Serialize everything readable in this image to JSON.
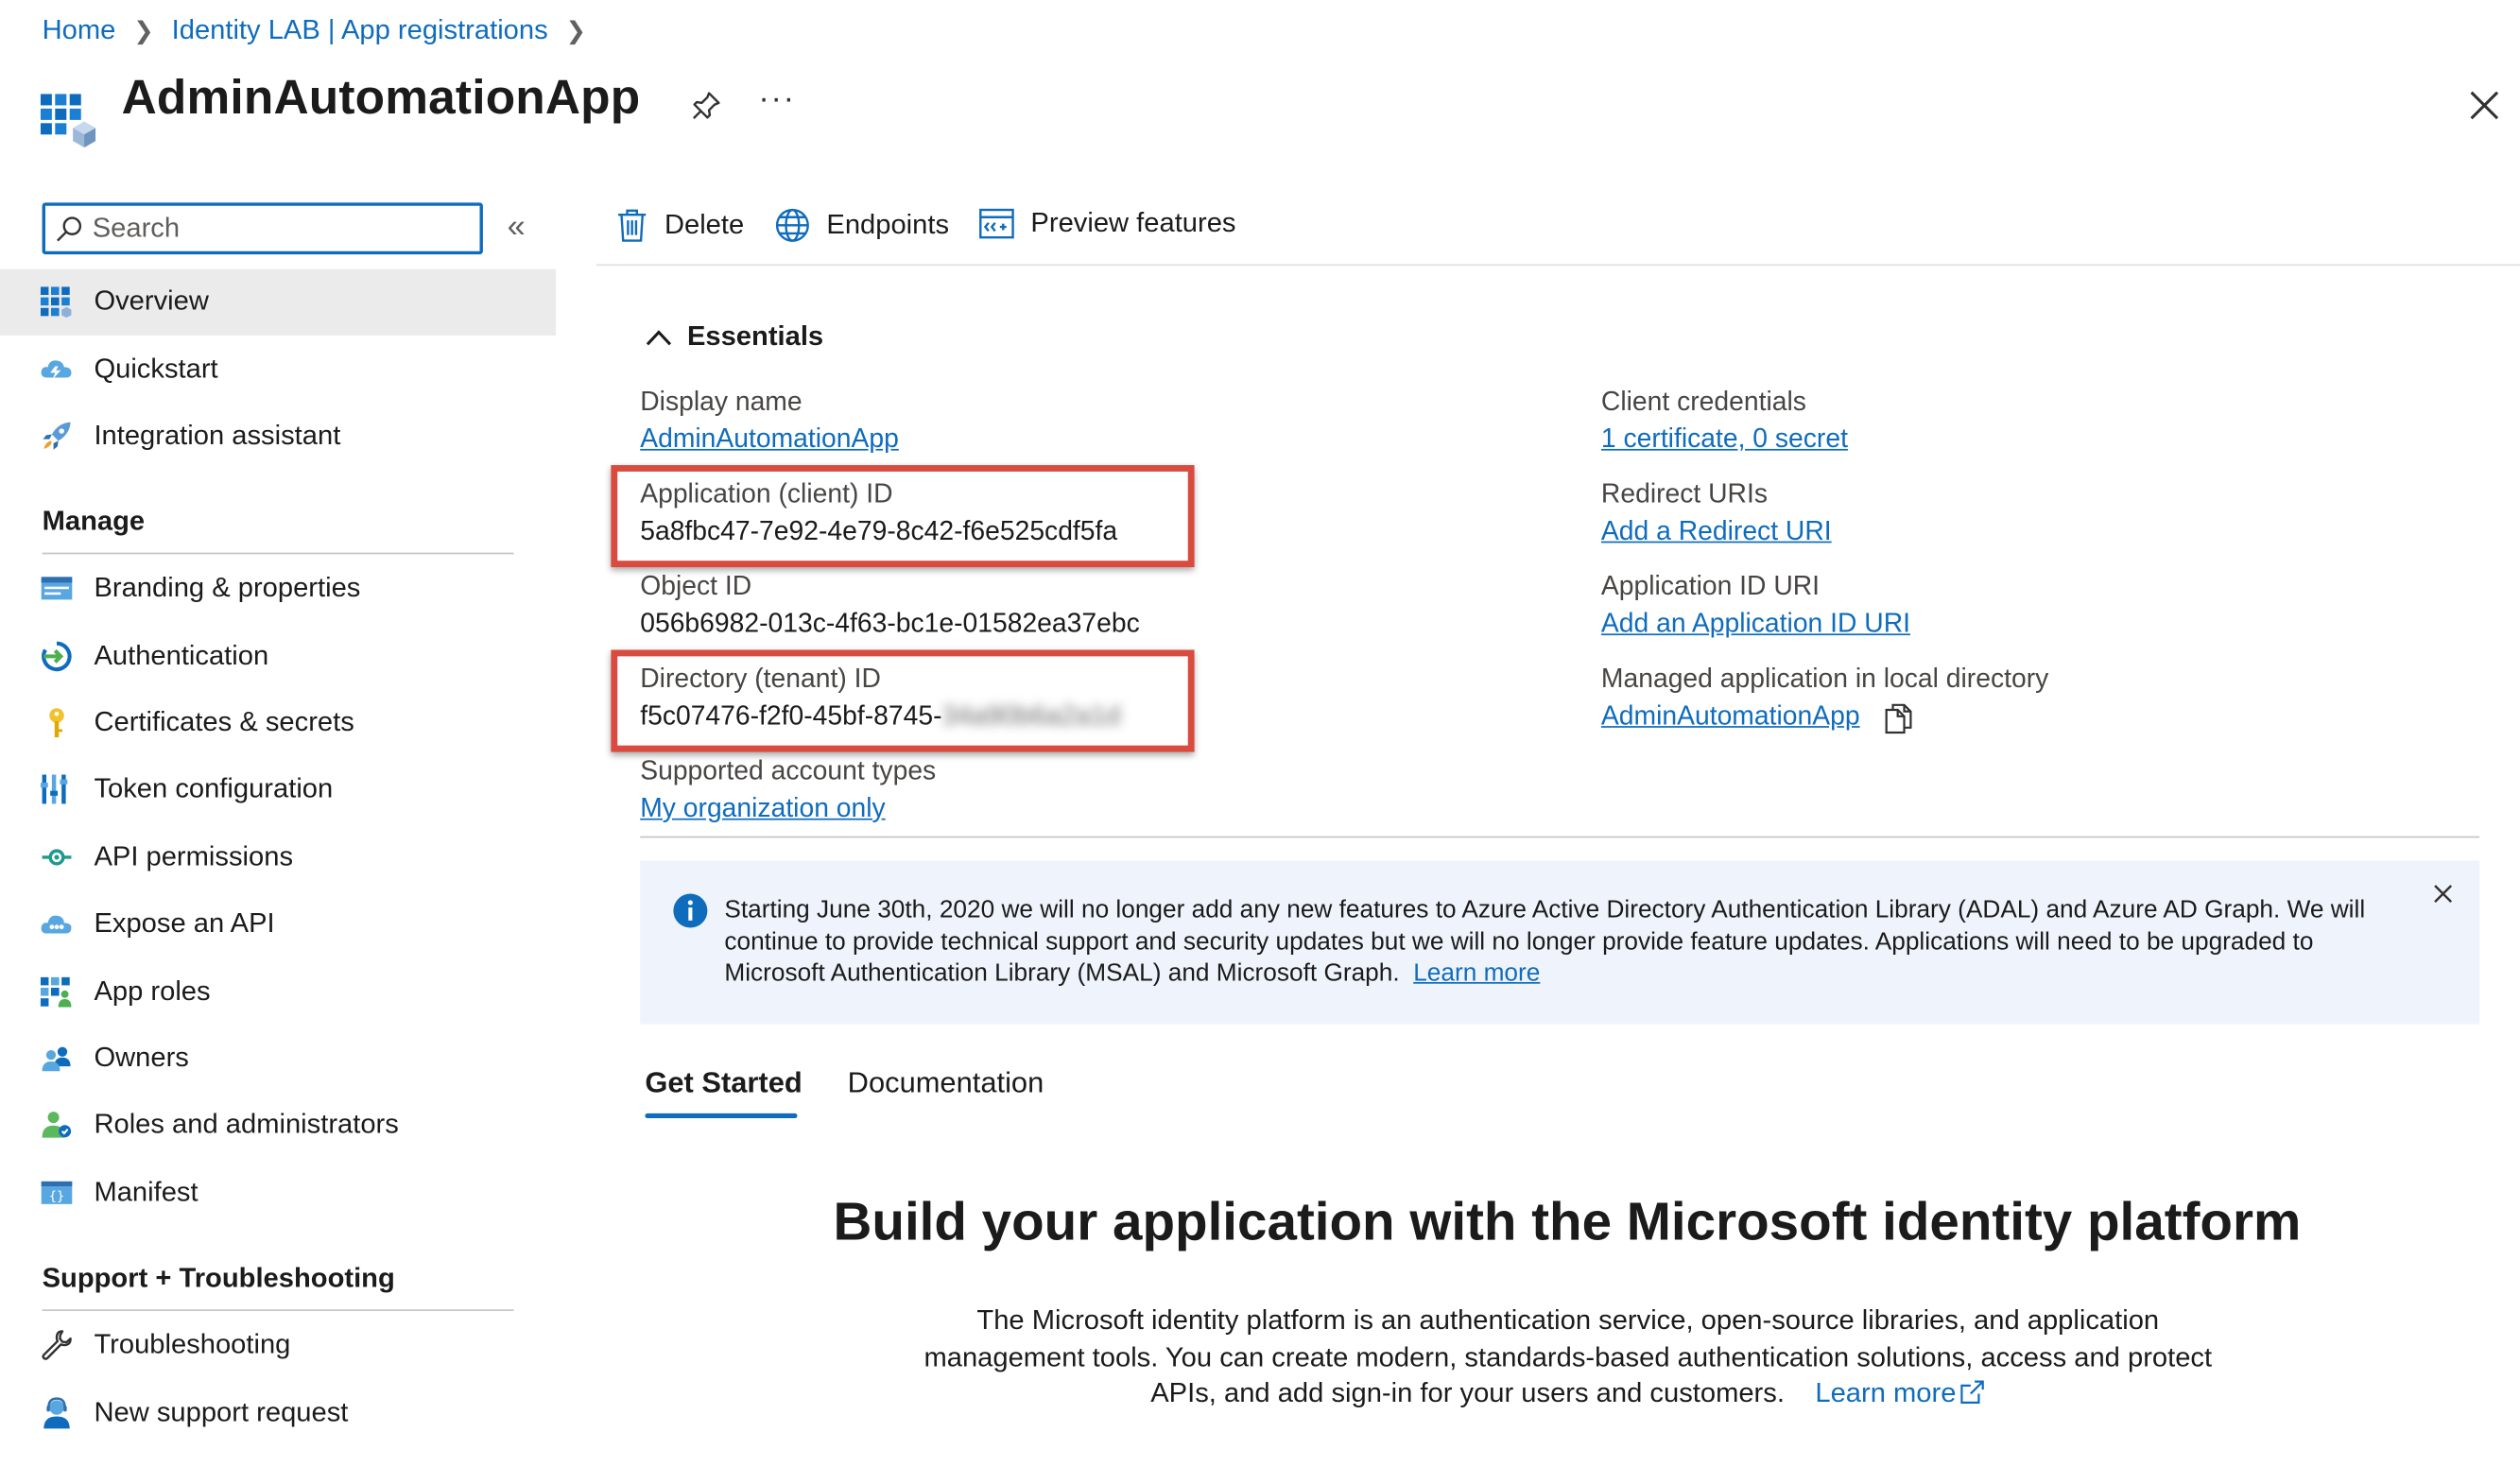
{
  "breadcrumb": {
    "items": [
      "Home",
      "Identity LAB | App registrations"
    ],
    "separator": ">"
  },
  "page": {
    "title": "AdminAutomationApp",
    "more": "···"
  },
  "sidebar": {
    "search_placeholder": "Search",
    "collapse": "«",
    "items_top": [
      {
        "label": "Overview",
        "icon": "overview-icon",
        "active": true
      },
      {
        "label": "Quickstart",
        "icon": "quickstart-cloud-icon"
      },
      {
        "label": "Integration assistant",
        "icon": "rocket-icon"
      }
    ],
    "manage_header": "Manage",
    "manage_items": [
      {
        "label": "Branding & properties",
        "icon": "branding-icon"
      },
      {
        "label": "Authentication",
        "icon": "authentication-icon"
      },
      {
        "label": "Certificates & secrets",
        "icon": "key-icon"
      },
      {
        "label": "Token configuration",
        "icon": "token-bars-icon"
      },
      {
        "label": "API permissions",
        "icon": "api-permissions-icon"
      },
      {
        "label": "Expose an API",
        "icon": "expose-api-cloud-icon"
      },
      {
        "label": "App roles",
        "icon": "app-roles-grid-icon"
      },
      {
        "label": "Owners",
        "icon": "owners-icon"
      },
      {
        "label": "Roles and administrators",
        "icon": "roles-admins-icon"
      },
      {
        "label": "Manifest",
        "icon": "manifest-icon"
      }
    ],
    "support_header": "Support + Troubleshooting",
    "support_items": [
      {
        "label": "Troubleshooting",
        "icon": "wrench-icon"
      },
      {
        "label": "New support request",
        "icon": "support-person-icon"
      }
    ]
  },
  "toolbar": {
    "delete": "Delete",
    "endpoints": "Endpoints",
    "preview": "Preview features"
  },
  "essentials": {
    "header": "Essentials",
    "left": {
      "display_name_label": "Display name",
      "display_name_value": "AdminAutomationApp",
      "client_id_label": "Application (client) ID",
      "client_id_value": "5a8fbc47-7e92-4e79-8c42-f6e525cdf5fa",
      "object_id_label": "Object ID",
      "object_id_value": "056b6982-013c-4f63-bc1e-01582ea37ebc",
      "tenant_id_label": "Directory (tenant) ID",
      "tenant_id_value": "f5c07476-f2f0-45bf-8745-",
      "tenant_id_redacted": "34a90b6a2a1d",
      "account_types_label": "Supported account types",
      "account_types_value": "My organization only"
    },
    "right": {
      "client_credentials_label": "Client credentials",
      "client_credentials_value": "1 certificate, 0 secret",
      "redirect_uris_label": "Redirect URIs",
      "redirect_uris_value": "Add a Redirect URI",
      "app_id_uri_label": "Application ID URI",
      "app_id_uri_value": "Add an Application ID URI",
      "managed_app_label": "Managed application in local directory",
      "managed_app_value": "AdminAutomationApp"
    }
  },
  "banner": {
    "message": "Starting June 30th, 2020 we will no longer add any new features to Azure Active Directory Authentication Library (ADAL) and Azure AD Graph. We will continue to provide technical support and security updates but we will no longer provide feature updates. Applications will need to be upgraded to Microsoft Authentication Library (MSAL) and Microsoft Graph.",
    "link": "Learn more"
  },
  "tabs": {
    "get_started": "Get Started",
    "documentation": "Documentation"
  },
  "hero": {
    "title": "Build your application with the Microsoft identity platform",
    "description": "The Microsoft identity platform is an authentication service, open-source libraries, and application management tools. You can create modern, standards-based authentication solutions, access and protect APIs, and add sign-in for your users and customers.",
    "learn_more": "Learn more"
  },
  "colors": {
    "accent": "#0f6cbd",
    "highlight_box": "#d94a3f",
    "banner_bg": "#eff3fb",
    "active_nav_bg": "#ebebeb"
  }
}
